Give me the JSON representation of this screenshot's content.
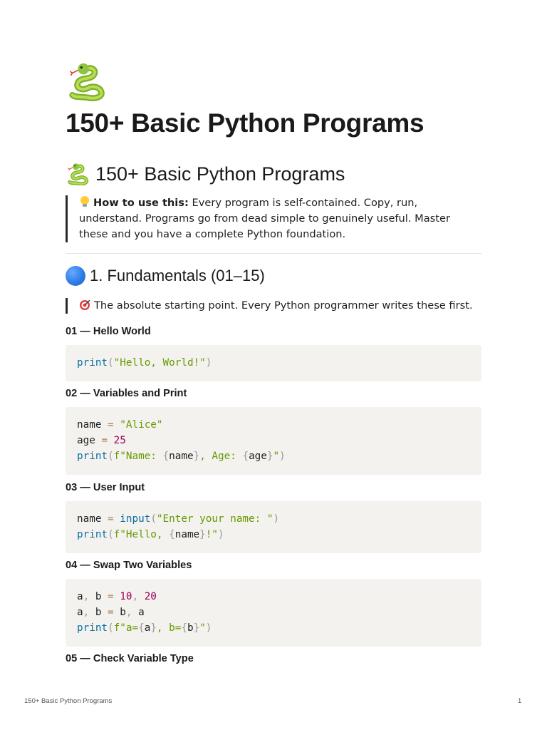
{
  "page": {
    "icon": "snake-emoji",
    "title": "150+ Basic Python Programs"
  },
  "heading1": {
    "icon": "snake-emoji",
    "text": "150+ Basic Python Programs"
  },
  "intro_callout": {
    "icon": "lightbulb-emoji",
    "bold": "How to use this:",
    "text": " Every program is self-contained. Copy, run, understand. Programs go from dead simple to genuinely useful. Master these and you have a complete Python foundation."
  },
  "section1": {
    "icon": "blue-circle-emoji",
    "title": "1. Fundamentals (01–15)",
    "callout_icon": "direct-hit-emoji",
    "callout": "The absolute starting point. Every Python programmer writes these first."
  },
  "programs": [
    {
      "title": "01 — Hello World",
      "code": [
        [
          [
            "kw",
            "print"
          ],
          [
            "pn",
            "("
          ],
          [
            "str",
            "\"Hello, World!\""
          ],
          [
            "pn",
            ")"
          ]
        ]
      ]
    },
    {
      "title": "02 — Variables and Print",
      "code": [
        [
          [
            "",
            "name "
          ],
          [
            "op",
            "="
          ],
          [
            "str",
            " \"Alice\""
          ]
        ],
        [
          [
            "",
            "age "
          ],
          [
            "op",
            "="
          ],
          [
            "num",
            " 25"
          ]
        ],
        [
          [
            "kw",
            "print"
          ],
          [
            "pn",
            "("
          ],
          [
            "str",
            "f\"Name: "
          ],
          [
            "pn",
            "{"
          ],
          [
            "",
            "name"
          ],
          [
            "pn",
            "}"
          ],
          [
            "str",
            ", Age: "
          ],
          [
            "pn",
            "{"
          ],
          [
            "",
            "age"
          ],
          [
            "pn",
            "}"
          ],
          [
            "str",
            "\""
          ],
          [
            "pn",
            ")"
          ]
        ]
      ]
    },
    {
      "title": "03 — User Input",
      "code": [
        [
          [
            "",
            "name "
          ],
          [
            "op",
            "="
          ],
          [
            "kw",
            " input"
          ],
          [
            "pn",
            "("
          ],
          [
            "str",
            "\"Enter your name: \""
          ],
          [
            "pn",
            ")"
          ]
        ],
        [
          [
            "kw",
            "print"
          ],
          [
            "pn",
            "("
          ],
          [
            "str",
            "f\"Hello, "
          ],
          [
            "pn",
            "{"
          ],
          [
            "",
            "name"
          ],
          [
            "pn",
            "}"
          ],
          [
            "str",
            "!\""
          ],
          [
            "pn",
            ")"
          ]
        ]
      ]
    },
    {
      "title": "04 — Swap Two Variables",
      "code": [
        [
          [
            "",
            "a"
          ],
          [
            "pn",
            ","
          ],
          [
            "",
            " b "
          ],
          [
            "op",
            "="
          ],
          [
            "num",
            " 10"
          ],
          [
            "pn",
            ","
          ],
          [
            "num",
            " 20"
          ]
        ],
        [
          [
            "",
            "a"
          ],
          [
            "pn",
            ","
          ],
          [
            "",
            " b "
          ],
          [
            "op",
            "="
          ],
          [
            "",
            " b"
          ],
          [
            "pn",
            ","
          ],
          [
            "",
            " a"
          ]
        ],
        [
          [
            "kw",
            "print"
          ],
          [
            "pn",
            "("
          ],
          [
            "str",
            "f\"a="
          ],
          [
            "pn",
            "{"
          ],
          [
            "",
            "a"
          ],
          [
            "pn",
            "}"
          ],
          [
            "str",
            ", b="
          ],
          [
            "pn",
            "{"
          ],
          [
            "",
            "b"
          ],
          [
            "pn",
            "}"
          ],
          [
            "str",
            "\""
          ],
          [
            "pn",
            ")"
          ]
        ]
      ]
    },
    {
      "title": "05 — Check Variable Type",
      "code": []
    }
  ],
  "footer": {
    "left": "150+ Basic Python Programs",
    "page_number": "1"
  }
}
